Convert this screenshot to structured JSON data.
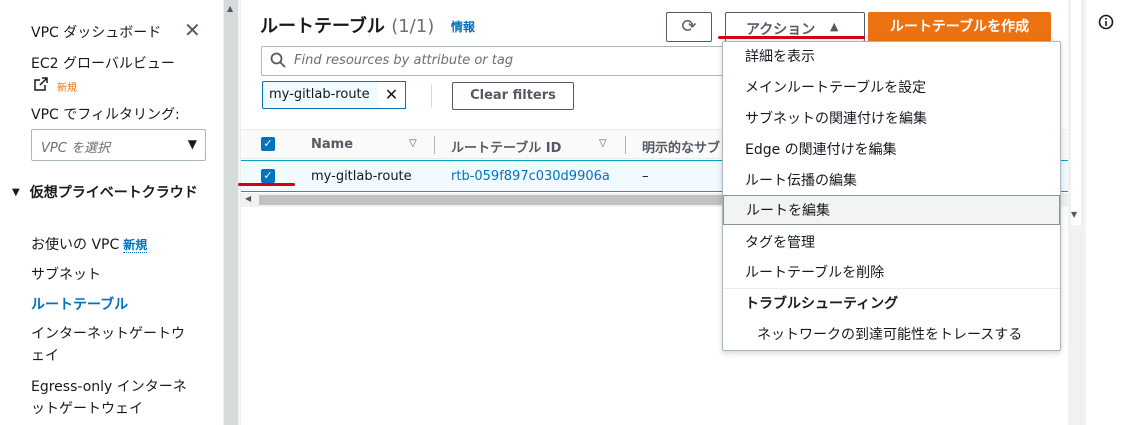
{
  "sidebar": {
    "title": "VPC ダッシュボード",
    "global_view": "EC2 グローバルビュー",
    "new_badge_small": "新規",
    "filter_label": "VPC でフィルタリング:",
    "vpc_select_placeholder": "VPC を選択",
    "section": "仮想プライベートクラウド",
    "items": [
      {
        "label": "お使いの VPC",
        "badge": "新規"
      },
      {
        "label": "サブネット"
      },
      {
        "label": "ルートテーブル"
      },
      {
        "label": "インターネットゲートウェイ"
      },
      {
        "label": "Egress-only インターネットゲートウェイ"
      }
    ]
  },
  "header": {
    "title": "ルートテーブル",
    "count": "(1/1)",
    "info": "情報",
    "actions_label": "アクション",
    "create_label": "ルートテーブルを作成"
  },
  "search": {
    "placeholder": "Find resources by attribute or tag",
    "token": "my-gitlab-route",
    "clear_label": "Clear filters"
  },
  "table": {
    "columns": [
      "Name",
      "ルートテーブル ID",
      "明示的なサブ"
    ],
    "rows": [
      {
        "name": "my-gitlab-route",
        "id": "rtb-059f897c030d9906a",
        "explicit": "–"
      }
    ]
  },
  "actions_menu": {
    "items": [
      "詳細を表示",
      "メインルートテーブルを設定",
      "サブネットの関連付けを編集",
      "Edge の関連付けを編集",
      "ルート伝播の編集",
      "ルートを編集",
      "タグを管理",
      "ルートテーブルを削除"
    ],
    "group_label": "トラブルシューティング",
    "group_items": [
      "ネットワークの到達可能性をトレースする"
    ]
  },
  "colors": {
    "accent": "#0073bb",
    "primary_button": "#ec7211",
    "annotation_red": "#d0021b"
  }
}
